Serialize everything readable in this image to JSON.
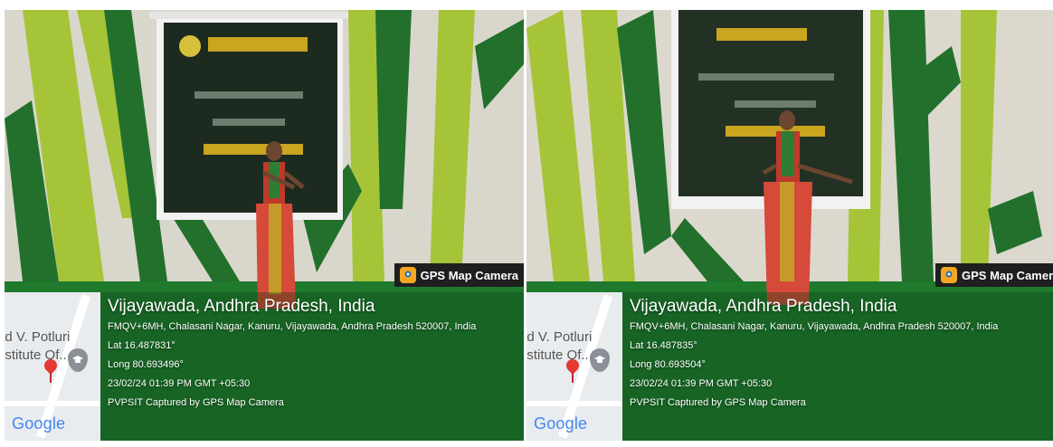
{
  "photos": [
    {
      "badge": "GPS Map Camera",
      "map": {
        "poi_line1": "ad V. Potluri",
        "poi_line2": "nstitute Of...",
        "logo": "Google"
      },
      "location_title": "Vijayawada, Andhra Pradesh, India",
      "address": "FMQV+6MH, Chalasani Nagar, Kanuru, Vijayawada, Andhra Pradesh 520007, India",
      "lat": "Lat 16.487831°",
      "long": "Long 80.693496°",
      "datetime": "23/02/24 01:39 PM GMT +05:30",
      "caption": "PVPSIT Captured by GPS Map Camera"
    },
    {
      "badge": "GPS Map Camera",
      "map": {
        "poi_line1": "ad V. Potluri",
        "poi_line2": "nstitute Of...",
        "logo": "Google"
      },
      "location_title": "Vijayawada, Andhra Pradesh, India",
      "address": "FMQV+6MH, Chalasani Nagar, Kanuru, Vijayawada, Andhra Pradesh 520007, India",
      "lat": "Lat 16.487835°",
      "long": "Long 80.693504°",
      "datetime": "23/02/24 01:39 PM GMT +05:30",
      "caption": "PVPSIT Captured by GPS Map Camera"
    }
  ],
  "colors": {
    "wall": "#d9d6cc",
    "stripe_light": "#a8c832",
    "stripe_dark": "#1e6b28",
    "floor": "#1f7a2e",
    "screen": "#1c1c1c",
    "badge_bg": "#1f1f1f"
  }
}
